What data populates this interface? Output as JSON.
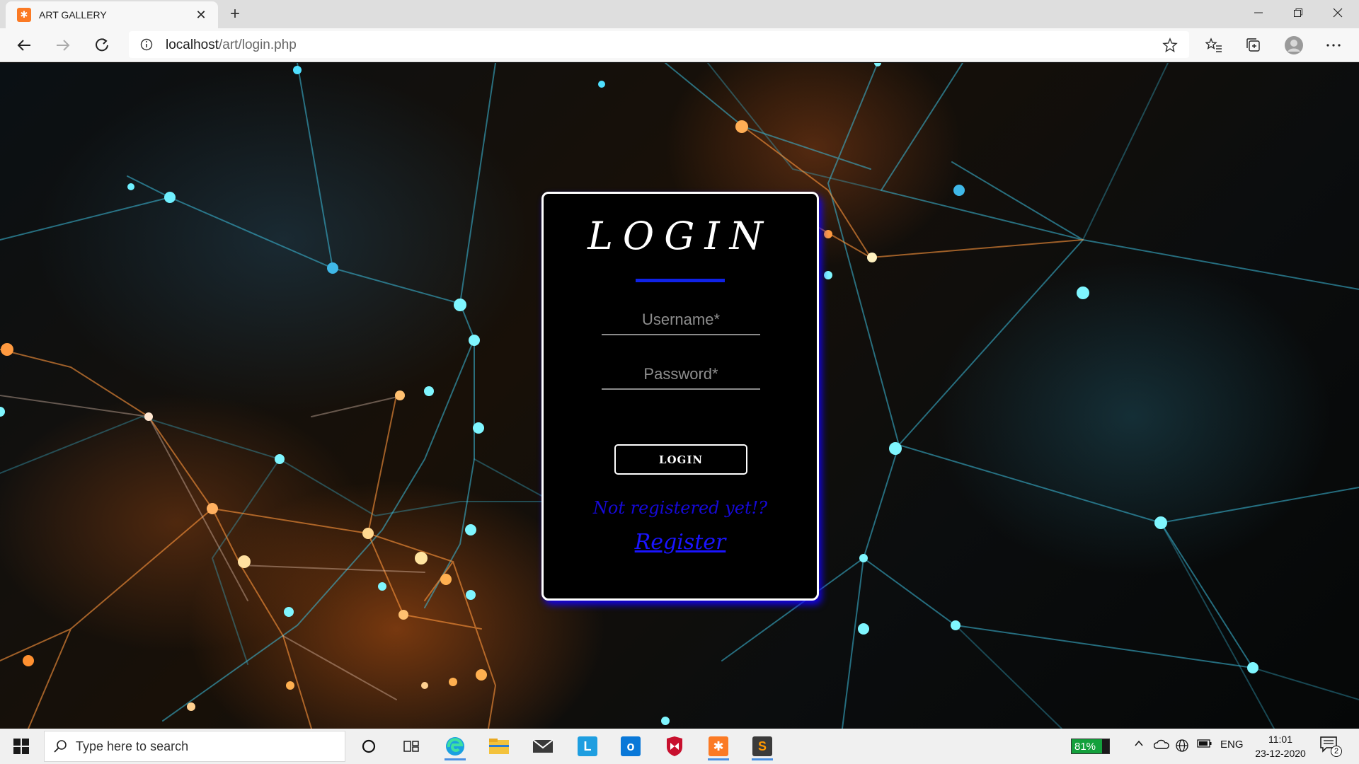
{
  "browser": {
    "tab_title": "ART GALLERY",
    "url_host": "localhost",
    "url_path": "/art/login.php"
  },
  "login": {
    "title": "LOGIN",
    "username_placeholder": "Username*",
    "password_placeholder": "Password*",
    "button_label": "LOGIN",
    "hint": "Not registered yet!?",
    "register_label": "Register"
  },
  "taskbar": {
    "search_placeholder": "Type here to search",
    "battery_percent": "81%",
    "battery_level": 0.81,
    "language": "ENG",
    "time": "11:01",
    "date": "23-12-2020",
    "notification_count": "2",
    "apps": [
      "cortana-icon",
      "task-view-icon",
      "edge-icon",
      "file-explorer-icon",
      "mail-icon",
      "app-l-icon",
      "app-o-icon",
      "mcafee-icon",
      "xampp-icon",
      "sublime-icon"
    ]
  },
  "colors": {
    "accent_blue": "#0f22e6",
    "link_blue": "#1a14ff",
    "card_bg": "#000000"
  }
}
